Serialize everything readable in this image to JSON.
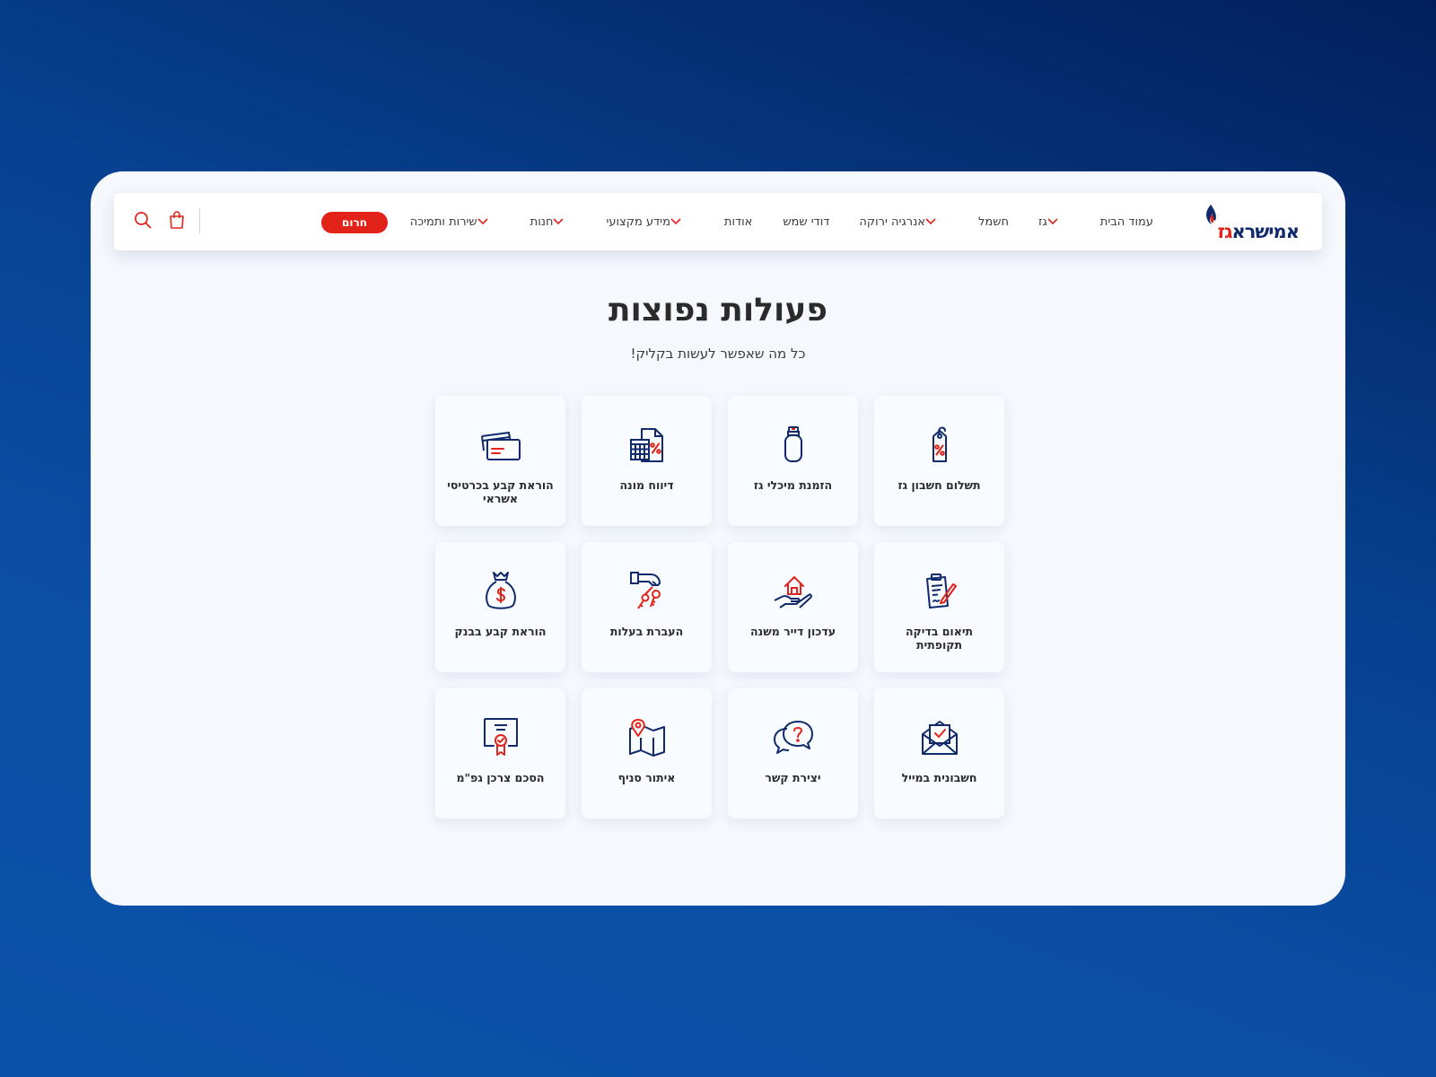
{
  "brand": {
    "logo_text_blue": "אמישרא",
    "logo_text_red": "גז",
    "blue": "#102a6b",
    "red": "#e2231a"
  },
  "nav": {
    "items": [
      {
        "label": "עמוד הבית",
        "dropdown": false
      },
      {
        "label": "גז",
        "dropdown": true
      },
      {
        "label": "חשמל",
        "dropdown": false
      },
      {
        "label": "אנרגיה ירוקה",
        "dropdown": true
      },
      {
        "label": "דודי שמש",
        "dropdown": false
      },
      {
        "label": "אודות",
        "dropdown": false
      },
      {
        "label": "מידע מקצועי",
        "dropdown": true
      },
      {
        "label": "חנות",
        "dropdown": true
      },
      {
        "label": "שירות ותמיכה",
        "dropdown": true
      }
    ],
    "emergency_label": "חרום",
    "icons": [
      "cart-icon",
      "search-icon"
    ]
  },
  "page": {
    "title": "פעולות נפוצות",
    "subtitle": "כל מה שאפשר לעשות בקליק!"
  },
  "actions": [
    {
      "label": "תשלום חשבון גז",
      "icon": "price-tag-percent-icon"
    },
    {
      "label": "הזמנת מיכלי גז",
      "icon": "gas-cylinder-icon"
    },
    {
      "label": "דיווח מונה",
      "icon": "calculator-document-icon"
    },
    {
      "label": "הוראת קבע בכרטיסי אשראי",
      "icon": "credit-cards-icon"
    },
    {
      "label": "תיאום בדיקה תקופתית",
      "icon": "clipboard-pen-icon"
    },
    {
      "label": "עדכון דייר משנה",
      "icon": "house-hand-icon"
    },
    {
      "label": "העברת בעלות",
      "icon": "hand-keys-icon"
    },
    {
      "label": "הוראת קבע בבנק",
      "icon": "money-bag-icon"
    },
    {
      "label": "חשבונית במייל",
      "icon": "envelope-check-icon"
    },
    {
      "label": "יצירת קשר",
      "icon": "chat-question-icon"
    },
    {
      "label": "איתור סניף",
      "icon": "map-pin-icon"
    },
    {
      "label": "הסכם צרכן גפ\"מ",
      "icon": "certificate-icon"
    }
  ]
}
